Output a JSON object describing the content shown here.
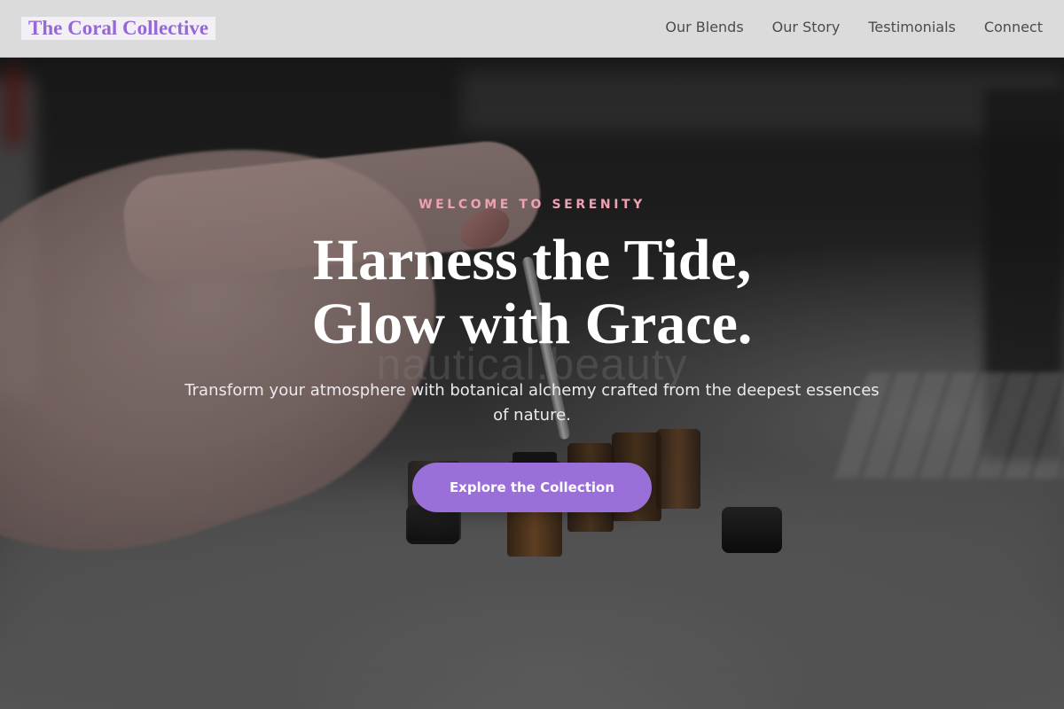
{
  "navbar": {
    "brand": "The Coral Collective",
    "links": [
      {
        "label": "Our Blends"
      },
      {
        "label": "Our Story"
      },
      {
        "label": "Testimonials"
      },
      {
        "label": "Connect"
      }
    ]
  },
  "hero": {
    "eyebrow": "WELCOME TO SERENITY",
    "headline_line1": "Harness the Tide,",
    "headline_line2": "Glow with Grace.",
    "subtext": "Transform your atmosphere with botanical alchemy crafted from the deepest essences of nature.",
    "cta_label": "Explore the Collection",
    "background_watermark": "nautical.beauty"
  },
  "colors": {
    "brand": "#9668d6",
    "accent_button": "#9a6fd9",
    "eyebrow": "#f0a1b0",
    "headline": "#ffffff"
  }
}
